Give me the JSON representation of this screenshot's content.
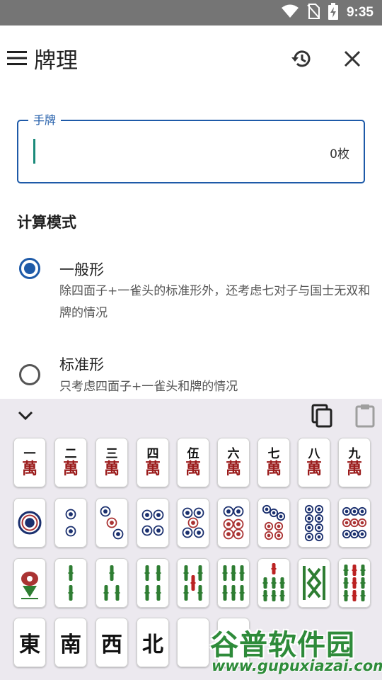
{
  "status_bar": {
    "time": "9:35"
  },
  "app_bar": {
    "title": "牌理"
  },
  "hand_input": {
    "label": "手牌",
    "value": "",
    "count": "0枚"
  },
  "mode_section": {
    "title": "计算模式",
    "options": [
      {
        "title": "一般形",
        "description": "除四面子+一雀头的标准形外，还考虑七对子与国士无双和牌的情况",
        "selected": true
      },
      {
        "title": "标准形",
        "description": "只考虑四面子+一雀头和牌的情况",
        "selected": false
      }
    ]
  },
  "keyboard": {
    "manzu": {
      "numerals": [
        "一",
        "二",
        "三",
        "四",
        "伍",
        "六",
        "七",
        "八",
        "九"
      ],
      "suit": "萬"
    },
    "pinzu": {
      "values": [
        1,
        2,
        3,
        4,
        5,
        6,
        7,
        8,
        9
      ]
    },
    "souzu": {
      "values": [
        1,
        2,
        3,
        4,
        5,
        6,
        7,
        8,
        9
      ]
    },
    "honors": [
      "東",
      "南",
      "西",
      "北",
      "",
      "",
      "",
      "",
      ""
    ]
  },
  "watermark": {
    "logo": "谷普软件园",
    "url": "www.gupuxiazai.com"
  },
  "colors": {
    "accent": "#1e5aa8",
    "cursor": "#1a8a7a",
    "manzu_red": "#9b1c1c",
    "bamboo_green": "#2e7d32",
    "circle_blue": "#1a2f6e"
  }
}
